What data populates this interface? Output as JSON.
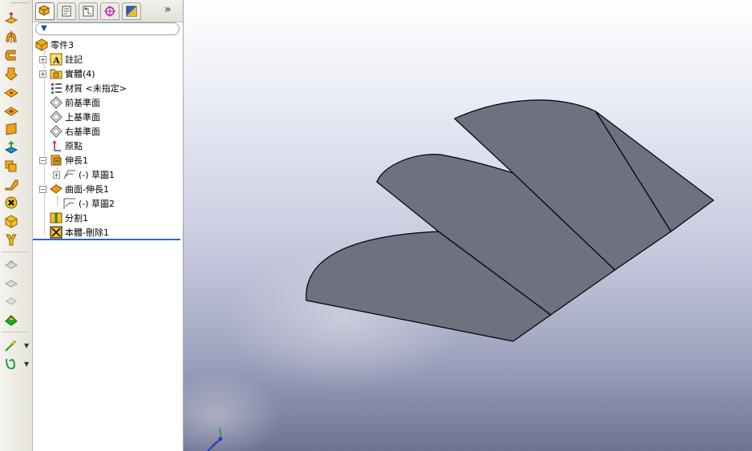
{
  "toolbar": {
    "tools": [
      {
        "name": "extruded-boss-icon"
      },
      {
        "name": "revolved-boss-icon"
      },
      {
        "name": "swept-boss-icon"
      },
      {
        "name": "lofted-boss-icon"
      },
      {
        "name": "extruded-cut-icon"
      },
      {
        "name": "revolved-cut-icon"
      },
      {
        "name": "fillet-icon"
      },
      {
        "name": "chamfer-icon"
      },
      {
        "name": "shell-icon"
      },
      {
        "name": "rib-icon"
      },
      {
        "name": "draft-icon"
      },
      {
        "name": "delete-body-icon"
      },
      {
        "name": "combine-icon"
      },
      {
        "name": "dome-icon"
      },
      {
        "name": "linear-pattern-icon"
      },
      {
        "name": "circular-pattern-icon"
      },
      {
        "name": "mirror-icon"
      },
      {
        "name": "reference-geometry-icon"
      },
      {
        "name": "curves-icon"
      },
      {
        "name": "instant3d-icon"
      }
    ]
  },
  "panel": {
    "tabs": [
      {
        "name": "feature-manager-tab"
      },
      {
        "name": "property-manager-tab"
      },
      {
        "name": "configuration-manager-tab"
      },
      {
        "name": "dimxpert-manager-tab"
      },
      {
        "name": "display-manager-tab"
      }
    ],
    "more": "»",
    "filter_placeholder": ""
  },
  "tree": {
    "root": "零件3",
    "items": [
      {
        "label": "註記"
      },
      {
        "label": "實體(4)"
      },
      {
        "label": "材質 <未指定>"
      },
      {
        "label": "前基準面"
      },
      {
        "label": "上基準面"
      },
      {
        "label": "右基準面"
      },
      {
        "label": "原點"
      },
      {
        "label": "伸長1"
      },
      {
        "label": "(-) 草圖1"
      },
      {
        "label": "曲面-伸長1"
      },
      {
        "label": "(-) 草圖2"
      },
      {
        "label": "分割1"
      },
      {
        "label": "本體-刪除1"
      }
    ]
  },
  "colors": {
    "surface_fill": "#6e7180",
    "edge": "#000000",
    "accent": "#2c64c4"
  }
}
